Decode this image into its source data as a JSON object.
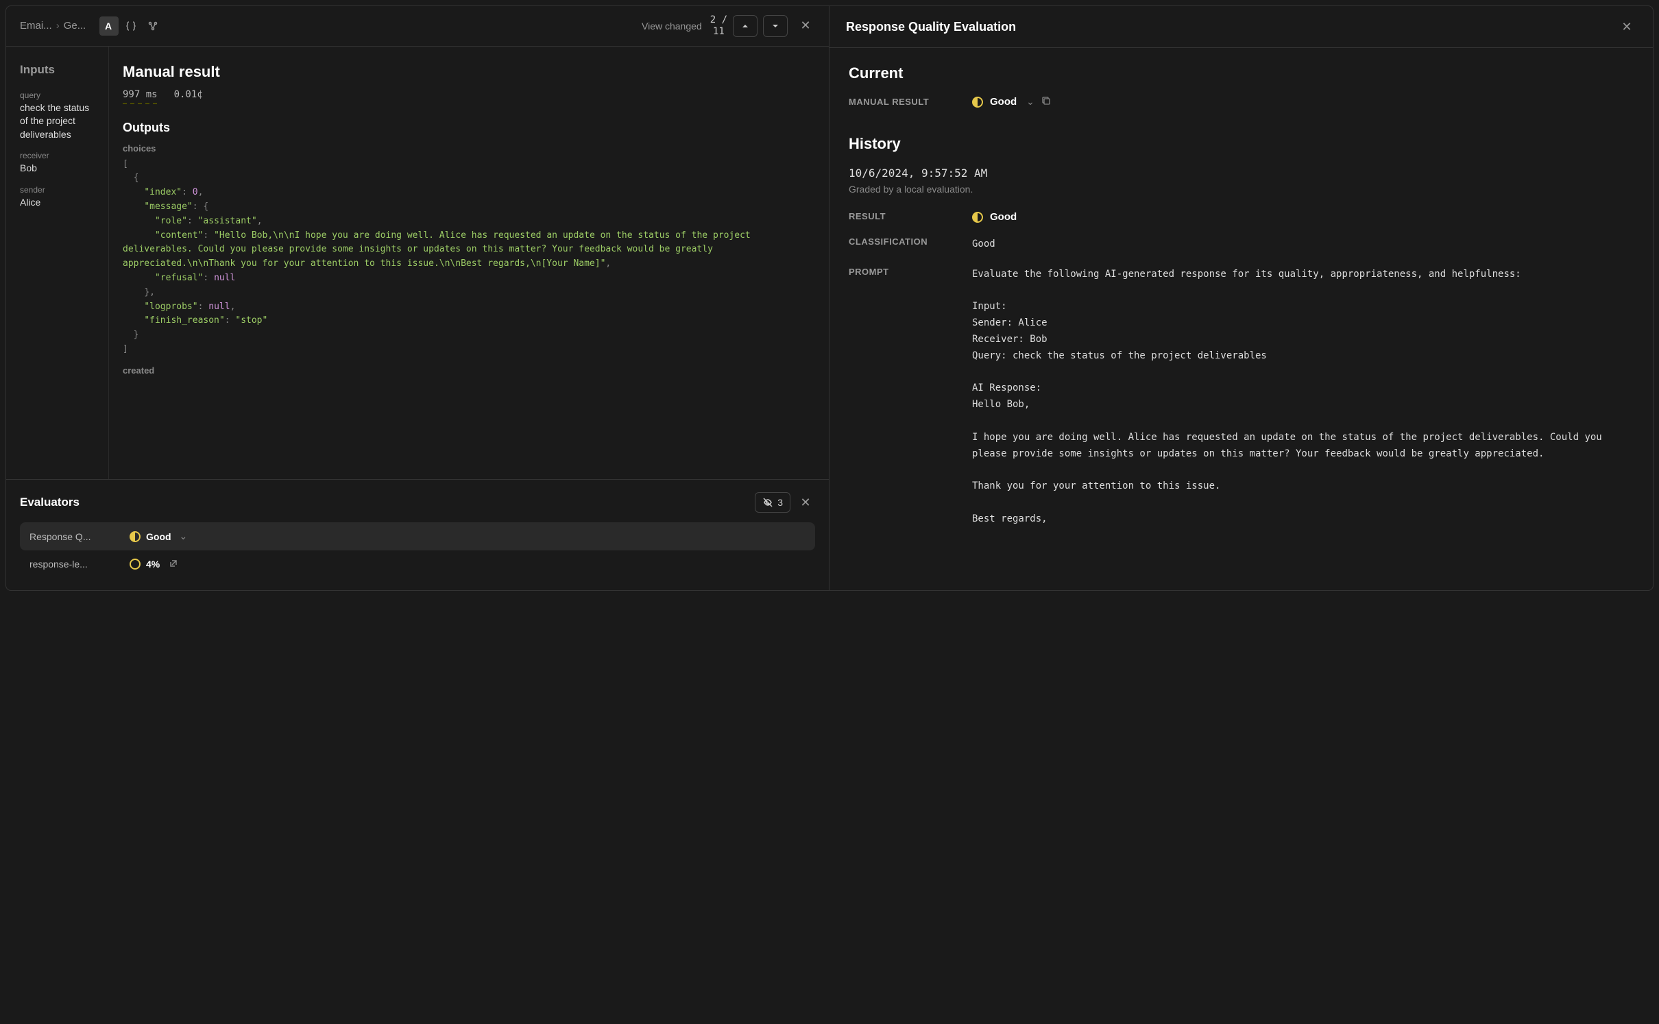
{
  "breadcrumb": {
    "item1": "Emai...",
    "item2": "Ge..."
  },
  "header": {
    "view_changed": "View changed",
    "pagination_current": "2",
    "pagination_total": "11"
  },
  "inputs": {
    "title": "Inputs",
    "query_label": "query",
    "query_value": "check the status of the project deliverables",
    "receiver_label": "receiver",
    "receiver_value": "Bob",
    "sender_label": "sender",
    "sender_value": "Alice"
  },
  "manual_result": {
    "title": "Manual result",
    "duration": "997 ms",
    "cost": "0.01¢"
  },
  "outputs": {
    "title": "Outputs",
    "choices_label": "choices",
    "created_label": "created",
    "data": {
      "choices": [
        {
          "index": 0,
          "message": {
            "role": "assistant",
            "content": "Hello Bob,\\n\\nI hope you are doing well. Alice has requested an update on the status of the project deliverables. Could you please provide some insights or updates on this matter? Your feedback would be greatly appreciated.\\n\\nThank you for your attention to this issue.\\n\\nBest regards,\\n[Your Name]",
            "refusal": null
          },
          "logprobs": null,
          "finish_reason": "stop"
        }
      ]
    }
  },
  "evaluators": {
    "title": "Evaluators",
    "hidden_count": "3",
    "rows": [
      {
        "name": "Response Q...",
        "value": "Good",
        "icon": "half"
      },
      {
        "name": "response-le...",
        "value": "4%",
        "icon": "outline"
      }
    ]
  },
  "right": {
    "title": "Response Quality Evaluation",
    "current": {
      "title": "Current",
      "manual_result_label": "MANUAL RESULT",
      "manual_result_value": "Good"
    },
    "history": {
      "title": "History",
      "timestamp": "10/6/2024, 9:57:52 AM",
      "description": "Graded by a local evaluation.",
      "result_label": "RESULT",
      "result_value": "Good",
      "classification_label": "CLASSIFICATION",
      "classification_value": "Good",
      "prompt_label": "PROMPT",
      "prompt_value": "Evaluate the following AI-generated response for its quality, appropriateness, and helpfulness:\n\nInput:\nSender: Alice\nReceiver: Bob\nQuery: check the status of the project deliverables\n\nAI Response:\nHello Bob,\n\nI hope you are doing well. Alice has requested an update on the status of the project deliverables. Could you please provide some insights or updates on this matter? Your feedback would be greatly appreciated.\n\nThank you for your attention to this issue.\n\nBest regards,"
    }
  }
}
